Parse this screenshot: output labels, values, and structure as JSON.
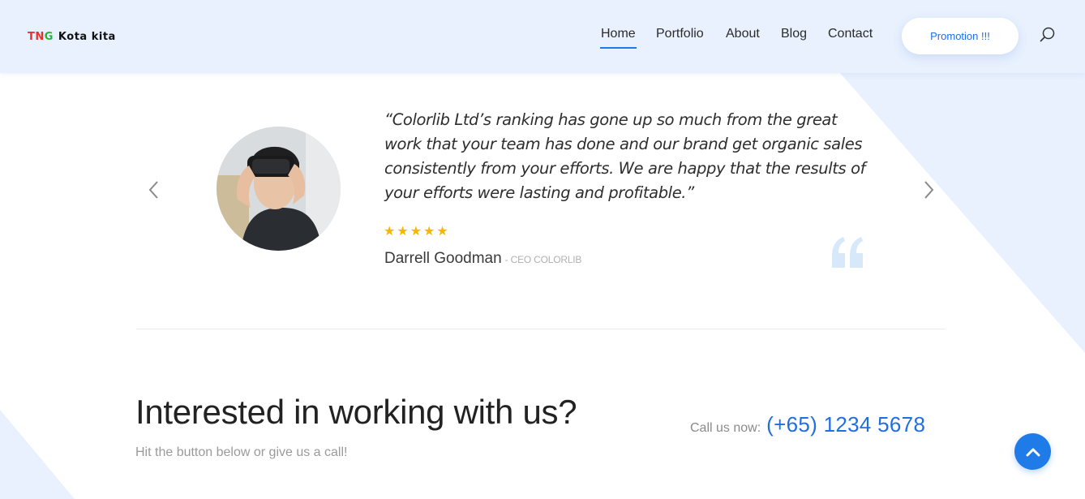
{
  "header": {
    "logo": {
      "part1": "TN",
      "part2": "G",
      "part3": "Kota kita"
    },
    "nav": [
      {
        "label": "Home",
        "active": true
      },
      {
        "label": "Portfolio",
        "active": false
      },
      {
        "label": "About",
        "active": false
      },
      {
        "label": "Blog",
        "active": false
      },
      {
        "label": "Contact",
        "active": false
      }
    ],
    "promo_label": "Promotion !!!"
  },
  "testimonial": {
    "quote": "“Colorlib Ltd’s ranking has gone up so much from the great work that your team has done and our brand get organic sales consistently from your efforts. We are happy that the results of your efforts were lasting and profitable.”",
    "rating": 5,
    "stars": "★★★★★",
    "author_name": "Darrell Goodman",
    "author_role": "- CEO COLORLIB"
  },
  "cta": {
    "title": "Interested in working with us?",
    "subtitle": "Hit the button below or give us a call!",
    "call_label": "Call us now:",
    "phone": "(+65) 1234 5678"
  },
  "colors": {
    "accent": "#1f7be8",
    "header_bg": "#e8f1fd",
    "star": "#f5b700"
  },
  "icons": {
    "search": "search-icon",
    "prev": "chevron-left-icon",
    "next": "chevron-right-icon",
    "quote": "quote-icon",
    "scroll_top": "chevron-up-icon"
  }
}
